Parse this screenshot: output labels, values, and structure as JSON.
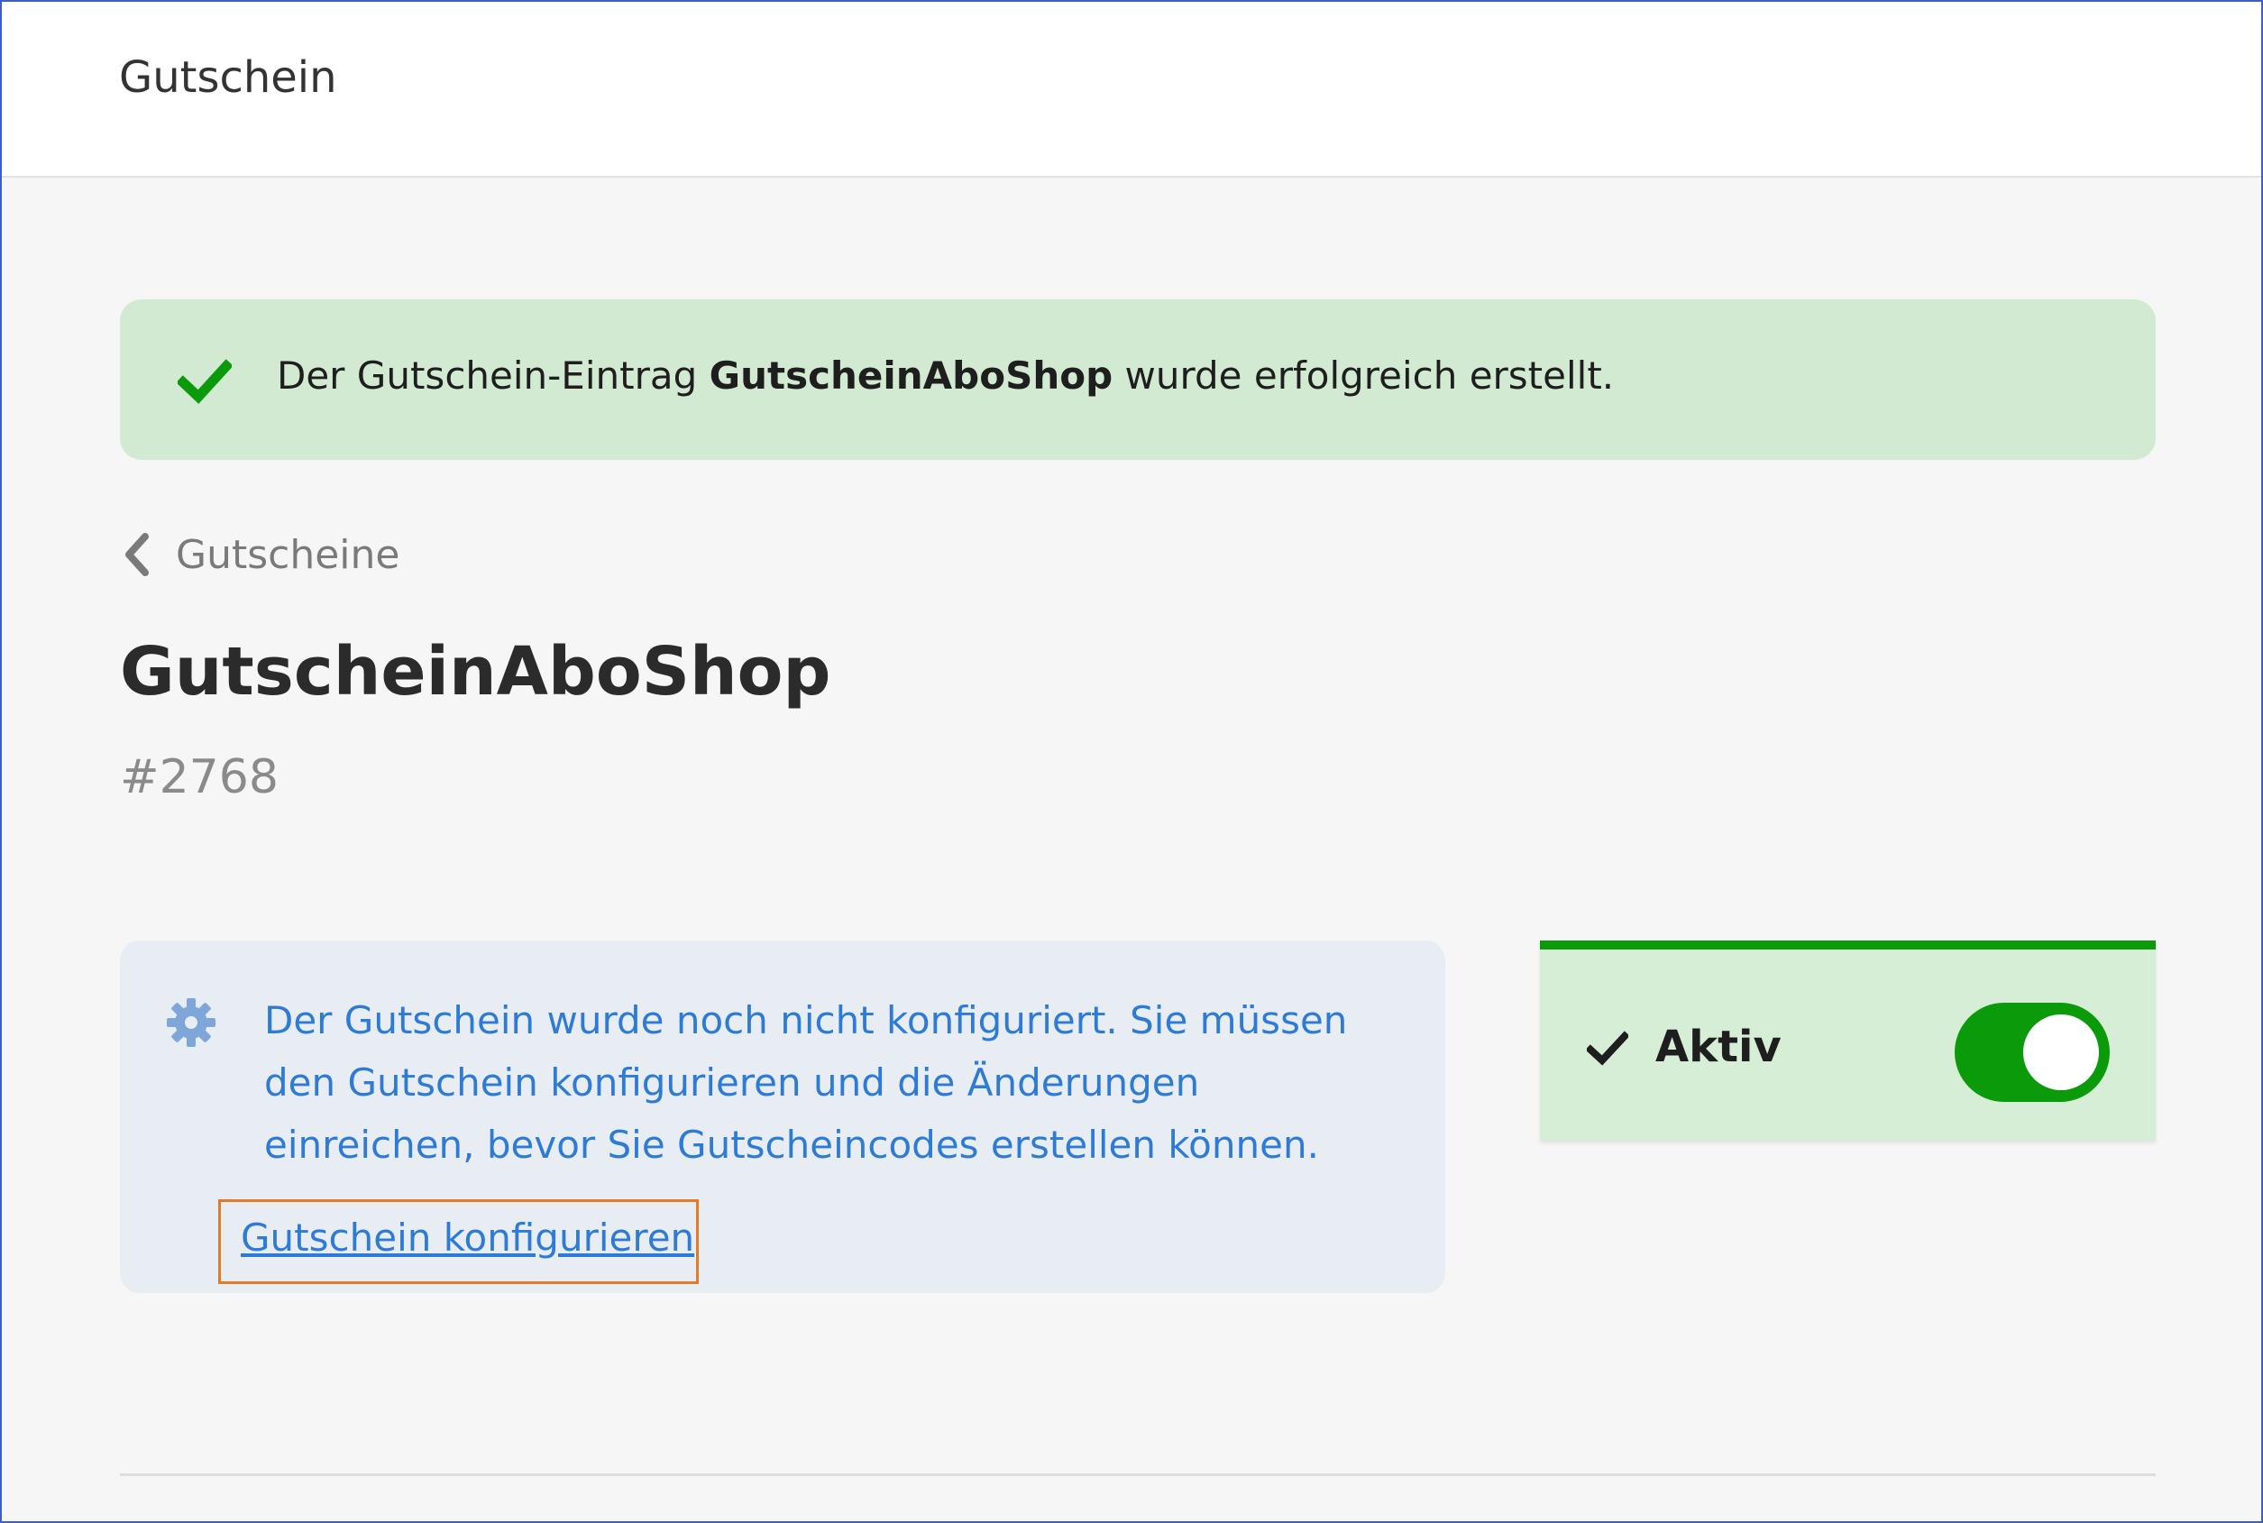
{
  "header": {
    "title": "Gutschein"
  },
  "banner": {
    "icon": "checkmark-icon",
    "text_before": "Der Gutschein-Eintrag ",
    "text_bold": "GutscheinAboShop",
    "text_after": " wurde erfolgreich erstellt.",
    "background_color": "#d3ead2",
    "icon_color": "#0a9a0a"
  },
  "breadcrumb": {
    "icon": "chevron-left-icon",
    "label": "Gutscheine"
  },
  "page": {
    "title": "GutscheinAboShop",
    "id": "#2768"
  },
  "info_box": {
    "icon": "gear-icon",
    "text": "Der Gutschein wurde noch nicht konfiguriert. Sie müssen den Gutschein konfigurieren und die Änderungen einreichen, bevor Sie Gutscheincodes erstellen können.",
    "link_label": "Gutschein konfigurieren",
    "text_color": "#2e7bd6",
    "highlight_color": "#e27a2b"
  },
  "status": {
    "icon": "checkmark-icon",
    "label": "Aktiv",
    "toggle_on": true,
    "accent_color": "#0a9a0a"
  }
}
